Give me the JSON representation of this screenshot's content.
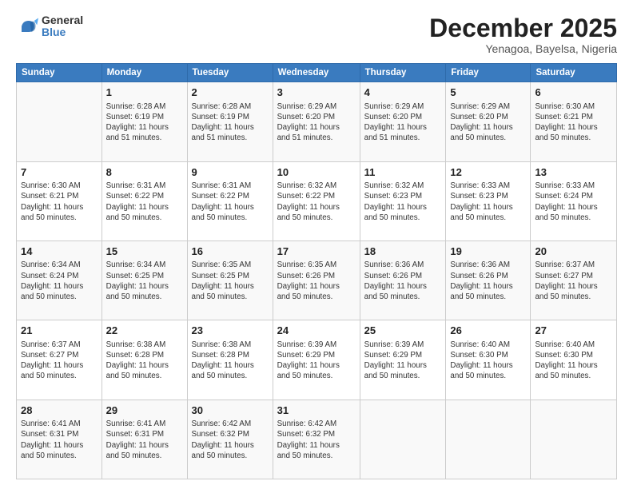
{
  "logo": {
    "line1": "General",
    "line2": "Blue"
  },
  "title": "December 2025",
  "subtitle": "Yenagoa, Bayelsa, Nigeria",
  "days_of_week": [
    "Sunday",
    "Monday",
    "Tuesday",
    "Wednesday",
    "Thursday",
    "Friday",
    "Saturday"
  ],
  "weeks": [
    [
      {
        "day": "",
        "info": ""
      },
      {
        "day": "1",
        "info": "Sunrise: 6:28 AM\nSunset: 6:19 PM\nDaylight: 11 hours\nand 51 minutes."
      },
      {
        "day": "2",
        "info": "Sunrise: 6:28 AM\nSunset: 6:19 PM\nDaylight: 11 hours\nand 51 minutes."
      },
      {
        "day": "3",
        "info": "Sunrise: 6:29 AM\nSunset: 6:20 PM\nDaylight: 11 hours\nand 51 minutes."
      },
      {
        "day": "4",
        "info": "Sunrise: 6:29 AM\nSunset: 6:20 PM\nDaylight: 11 hours\nand 51 minutes."
      },
      {
        "day": "5",
        "info": "Sunrise: 6:29 AM\nSunset: 6:20 PM\nDaylight: 11 hours\nand 50 minutes."
      },
      {
        "day": "6",
        "info": "Sunrise: 6:30 AM\nSunset: 6:21 PM\nDaylight: 11 hours\nand 50 minutes."
      }
    ],
    [
      {
        "day": "7",
        "info": "Sunrise: 6:30 AM\nSunset: 6:21 PM\nDaylight: 11 hours\nand 50 minutes."
      },
      {
        "day": "8",
        "info": "Sunrise: 6:31 AM\nSunset: 6:22 PM\nDaylight: 11 hours\nand 50 minutes."
      },
      {
        "day": "9",
        "info": "Sunrise: 6:31 AM\nSunset: 6:22 PM\nDaylight: 11 hours\nand 50 minutes."
      },
      {
        "day": "10",
        "info": "Sunrise: 6:32 AM\nSunset: 6:22 PM\nDaylight: 11 hours\nand 50 minutes."
      },
      {
        "day": "11",
        "info": "Sunrise: 6:32 AM\nSunset: 6:23 PM\nDaylight: 11 hours\nand 50 minutes."
      },
      {
        "day": "12",
        "info": "Sunrise: 6:33 AM\nSunset: 6:23 PM\nDaylight: 11 hours\nand 50 minutes."
      },
      {
        "day": "13",
        "info": "Sunrise: 6:33 AM\nSunset: 6:24 PM\nDaylight: 11 hours\nand 50 minutes."
      }
    ],
    [
      {
        "day": "14",
        "info": "Sunrise: 6:34 AM\nSunset: 6:24 PM\nDaylight: 11 hours\nand 50 minutes."
      },
      {
        "day": "15",
        "info": "Sunrise: 6:34 AM\nSunset: 6:25 PM\nDaylight: 11 hours\nand 50 minutes."
      },
      {
        "day": "16",
        "info": "Sunrise: 6:35 AM\nSunset: 6:25 PM\nDaylight: 11 hours\nand 50 minutes."
      },
      {
        "day": "17",
        "info": "Sunrise: 6:35 AM\nSunset: 6:26 PM\nDaylight: 11 hours\nand 50 minutes."
      },
      {
        "day": "18",
        "info": "Sunrise: 6:36 AM\nSunset: 6:26 PM\nDaylight: 11 hours\nand 50 minutes."
      },
      {
        "day": "19",
        "info": "Sunrise: 6:36 AM\nSunset: 6:26 PM\nDaylight: 11 hours\nand 50 minutes."
      },
      {
        "day": "20",
        "info": "Sunrise: 6:37 AM\nSunset: 6:27 PM\nDaylight: 11 hours\nand 50 minutes."
      }
    ],
    [
      {
        "day": "21",
        "info": "Sunrise: 6:37 AM\nSunset: 6:27 PM\nDaylight: 11 hours\nand 50 minutes."
      },
      {
        "day": "22",
        "info": "Sunrise: 6:38 AM\nSunset: 6:28 PM\nDaylight: 11 hours\nand 50 minutes."
      },
      {
        "day": "23",
        "info": "Sunrise: 6:38 AM\nSunset: 6:28 PM\nDaylight: 11 hours\nand 50 minutes."
      },
      {
        "day": "24",
        "info": "Sunrise: 6:39 AM\nSunset: 6:29 PM\nDaylight: 11 hours\nand 50 minutes."
      },
      {
        "day": "25",
        "info": "Sunrise: 6:39 AM\nSunset: 6:29 PM\nDaylight: 11 hours\nand 50 minutes."
      },
      {
        "day": "26",
        "info": "Sunrise: 6:40 AM\nSunset: 6:30 PM\nDaylight: 11 hours\nand 50 minutes."
      },
      {
        "day": "27",
        "info": "Sunrise: 6:40 AM\nSunset: 6:30 PM\nDaylight: 11 hours\nand 50 minutes."
      }
    ],
    [
      {
        "day": "28",
        "info": "Sunrise: 6:41 AM\nSunset: 6:31 PM\nDaylight: 11 hours\nand 50 minutes."
      },
      {
        "day": "29",
        "info": "Sunrise: 6:41 AM\nSunset: 6:31 PM\nDaylight: 11 hours\nand 50 minutes."
      },
      {
        "day": "30",
        "info": "Sunrise: 6:42 AM\nSunset: 6:32 PM\nDaylight: 11 hours\nand 50 minutes."
      },
      {
        "day": "31",
        "info": "Sunrise: 6:42 AM\nSunset: 6:32 PM\nDaylight: 11 hours\nand 50 minutes."
      },
      {
        "day": "",
        "info": ""
      },
      {
        "day": "",
        "info": ""
      },
      {
        "day": "",
        "info": ""
      }
    ]
  ]
}
